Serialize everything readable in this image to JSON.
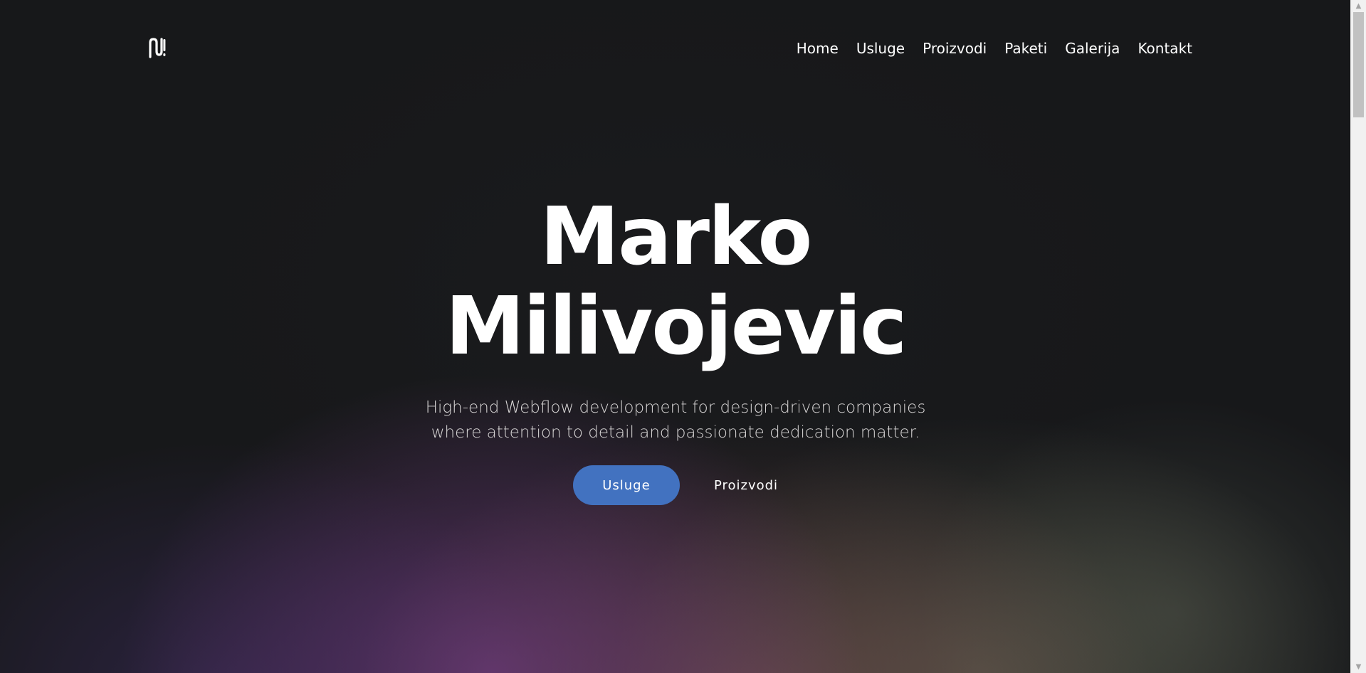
{
  "brand": {
    "logo_icon": "m-logo-icon"
  },
  "nav": {
    "items": [
      {
        "label": "Home"
      },
      {
        "label": "Usluge"
      },
      {
        "label": "Proizvodi"
      },
      {
        "label": "Paketi"
      },
      {
        "label": "Galerija"
      },
      {
        "label": "Kontakt"
      }
    ]
  },
  "hero": {
    "title_line1": "Marko",
    "title_line2": "Milivojevic",
    "subtitle_line1": "High-end Webflow development for design-driven companies",
    "subtitle_line2": "where attention to detail and passionate dedication matter.",
    "primary_button": "Usluge",
    "secondary_button": "Proizvodi"
  },
  "colors": {
    "background": "#17181a",
    "accent": "#4272c0",
    "text": "#ffffff",
    "subtitle": "#d8d6d6"
  },
  "scrollbar": {
    "up_icon": "scroll-up-arrow-icon",
    "down_icon": "scroll-down-arrow-icon"
  }
}
